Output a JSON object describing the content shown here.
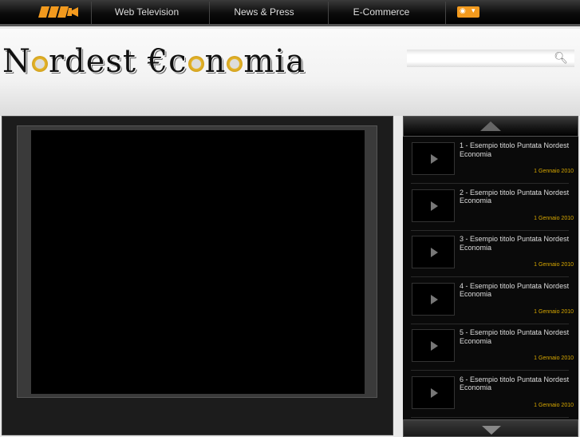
{
  "nav": {
    "items": [
      "Web Television",
      "News & Press",
      "E-Commerce"
    ],
    "rss_icon": "rss-feed-icon",
    "logo_icon": "video-camera-logo-icon",
    "accent": "#f39a1e"
  },
  "header": {
    "logo_text": "Nordest €conomia",
    "search_placeholder": "",
    "search_icon": "magnifier-icon"
  },
  "playlist": {
    "date_color": "#d9a900",
    "items": [
      {
        "title": "1 - Esempio titolo Puntata Nordest Economia",
        "date": "1 Gennaio 2010"
      },
      {
        "title": "2 - Esempio titolo Puntata Nordest Economia",
        "date": "1 Gennaio 2010"
      },
      {
        "title": "3 - Esempio titolo Puntata Nordest Economia",
        "date": "1 Gennaio 2010"
      },
      {
        "title": "4 - Esempio titolo Puntata Nordest Economia",
        "date": "1 Gennaio 2010"
      },
      {
        "title": "5 - Esempio titolo Puntata Nordest Economia",
        "date": "1 Gennaio 2010"
      },
      {
        "title": "6 - Esempio titolo Puntata Nordest Economia",
        "date": "1 Gennaio 2010"
      }
    ]
  }
}
